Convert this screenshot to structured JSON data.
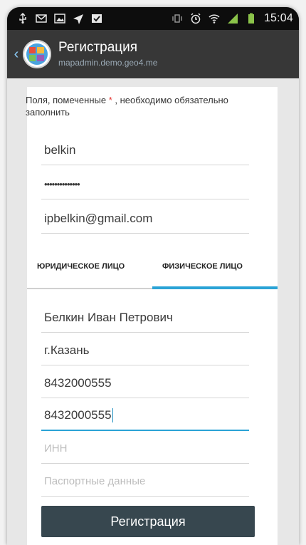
{
  "status_bar": {
    "time": "15:04",
    "icons_left": [
      "usb-icon",
      "mail-icon",
      "image-icon",
      "send-icon",
      "check-icon"
    ],
    "icons_right": [
      "vibrate-icon",
      "alarm-icon",
      "wifi-icon",
      "signal-icon",
      "battery-icon"
    ]
  },
  "app_bar": {
    "title": "Регистрация",
    "subtitle": "mapadmin.demo.geo4.me"
  },
  "form": {
    "note_prefix": "Поля, помеченные ",
    "note_asterisk": "*",
    "note_suffix": " , необходимо обязательно заполнить",
    "username": "belkin",
    "password": "••••••••••••••",
    "email": "ipbelkin@gmail.com",
    "tabs": [
      {
        "label": "ЮРИДИЧЕСКОЕ ЛИЦО",
        "active": false
      },
      {
        "label": "ФИЗИЧЕСКОЕ ЛИЦО",
        "active": true
      }
    ],
    "full_name": "Белкин Иван Петрович",
    "city": "г.Казань",
    "phone1": "8432000555",
    "phone2": "8432000555",
    "inn_placeholder": "ИНН",
    "passport_placeholder": "Паспортные данные",
    "register_button": "Регистрация"
  },
  "colors": {
    "accent": "#2aa3d6",
    "button": "#37474f",
    "required": "#e53935"
  }
}
